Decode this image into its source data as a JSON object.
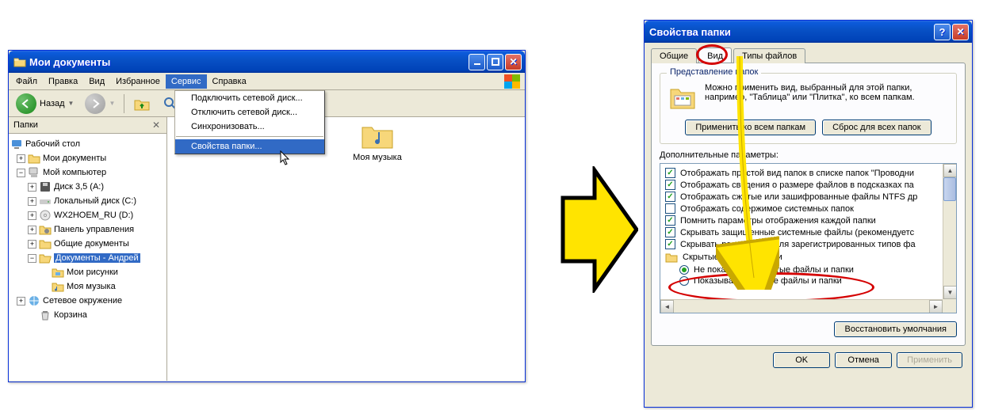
{
  "explorer": {
    "title": "Мои документы",
    "menu": {
      "file": "Файл",
      "edit": "Правка",
      "view": "Вид",
      "favorites": "Избранное",
      "tools": "Сервис",
      "help": "Справка"
    },
    "toolbar": {
      "back": "Назад"
    },
    "tools_menu": {
      "map_drive": "Подключить сетевой диск...",
      "unmap_drive": "Отключить сетевой диск...",
      "sync": "Синхронизовать...",
      "folder_options": "Свойства папки..."
    },
    "sidebar_title": "Папки",
    "tree": {
      "desktop": "Рабочий стол",
      "mydocs": "Мои документы",
      "mycomputer": "Мой компьютер",
      "floppy": "Диск 3,5 (A:)",
      "localdisk": "Локальный диск (C:)",
      "cddrive": "WX2HOEM_RU (D:)",
      "controlpanel": "Панель управления",
      "shareddocs": "Общие документы",
      "userdocs": "Документы - Андрей",
      "mypictures": "Мои рисунки",
      "mymusic": "Моя музыка",
      "network": "Сетевое окружение",
      "recycle": "Корзина"
    },
    "content": {
      "mymusic": "Моя музыка"
    }
  },
  "folderopts": {
    "title": "Свойства папки",
    "tabs": {
      "general": "Общие",
      "view": "Вид",
      "types": "Типы файлов"
    },
    "group_views": {
      "legend": "Представление папок",
      "desc": "Можно применить вид, выбранный для этой папки, например, \"Таблица\" или \"Плитка\", ко всем папкам.",
      "apply_all": "Применить ко всем папкам",
      "reset_all": "Сброс для всех папок"
    },
    "advanced_label": "Дополнительные параметры:",
    "opts": {
      "c1": "Отображать простой вид папок в списке папок \"Проводни",
      "c2": "Отображать сведения о размере файлов в подсказках па",
      "c3": "Отображать сжатые или зашифрованные файлы NTFS др",
      "c4": "Отображать содержимое системных папок",
      "c5": "Помнить параметры отображения каждой папки",
      "c6": "Скрывать защищенные системные файлы (рекомендуетс",
      "c7": "Скрывать расширения для зарегистрированных типов фа",
      "grp": "Скрытые файлы и папки",
      "r1": "Не показывать скрытые файлы и папки",
      "r2": "Показывать скрытые файлы и папки"
    },
    "restore_defaults": "Восстановить умолчания",
    "ok": "OK",
    "cancel": "Отмена",
    "apply": "Применить"
  }
}
